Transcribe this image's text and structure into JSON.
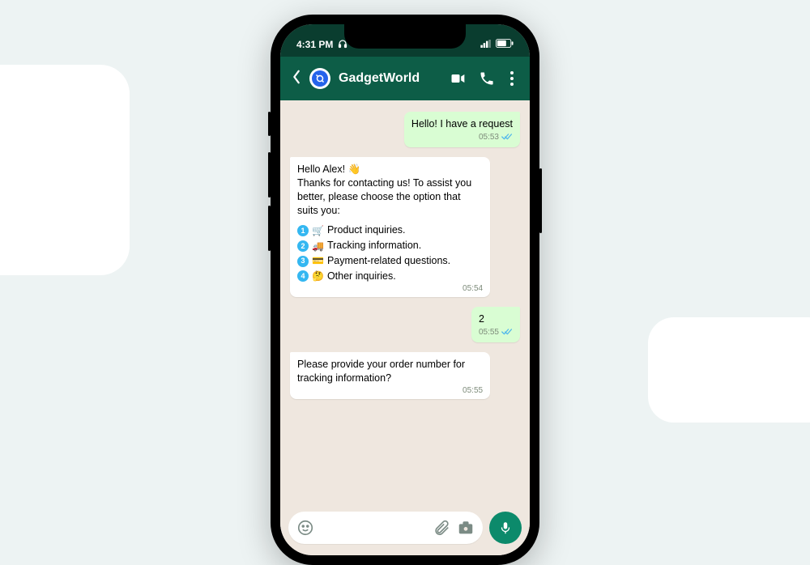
{
  "status": {
    "time": "4:31 PM"
  },
  "header": {
    "title": "GadgetWorld"
  },
  "messages": {
    "m1": {
      "text": "Hello! I have a request",
      "time": "05:53"
    },
    "m2": {
      "intro": "Hello Alex! 👋\nThanks for contacting us! To assist you better, please choose the option that suits you:",
      "options": [
        {
          "n": "1",
          "emoji": "🛒",
          "label": "Product inquiries."
        },
        {
          "n": "2",
          "emoji": "🚚",
          "label": "Tracking information."
        },
        {
          "n": "3",
          "emoji": "💳",
          "label": "Payment-related questions."
        },
        {
          "n": "4",
          "emoji": "🤔",
          "label": "Other inquiries."
        }
      ],
      "time": "05:54"
    },
    "m3": {
      "text": "2",
      "time": "05:55"
    },
    "m4": {
      "text": "Please provide your order number for tracking information?",
      "time": "05:55"
    }
  },
  "input": {
    "placeholder": ""
  }
}
